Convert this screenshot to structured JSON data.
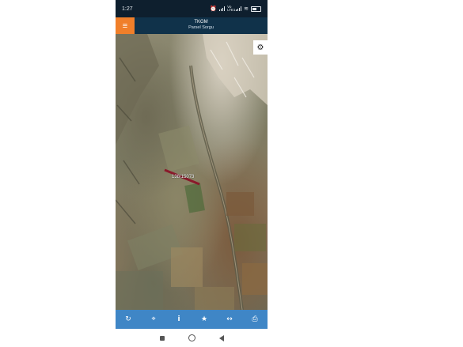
{
  "status_bar": {
    "time": "1:27",
    "network_label": "Vo LTE1",
    "battery_label": "LTE"
  },
  "header": {
    "title": "TKGM",
    "subtitle": "Parsel Sorgu",
    "menu_icon": "≡"
  },
  "map": {
    "settings_icon": "⚙",
    "parcel_label": "138/15073"
  },
  "toolbar": {
    "items": [
      {
        "name": "refresh-icon",
        "glyph": "↻"
      },
      {
        "name": "locate-icon",
        "glyph": "⌖"
      },
      {
        "name": "info-icon",
        "glyph": "i"
      },
      {
        "name": "favorite-icon",
        "glyph": "★"
      },
      {
        "name": "measure-icon",
        "glyph": "↔"
      },
      {
        "name": "print-icon",
        "glyph": "⎙"
      }
    ]
  },
  "colors": {
    "header": "#10324a",
    "menu": "#f07f2a",
    "toolbar": "#3f86c6",
    "parcel_line": "#8a1a2b"
  }
}
